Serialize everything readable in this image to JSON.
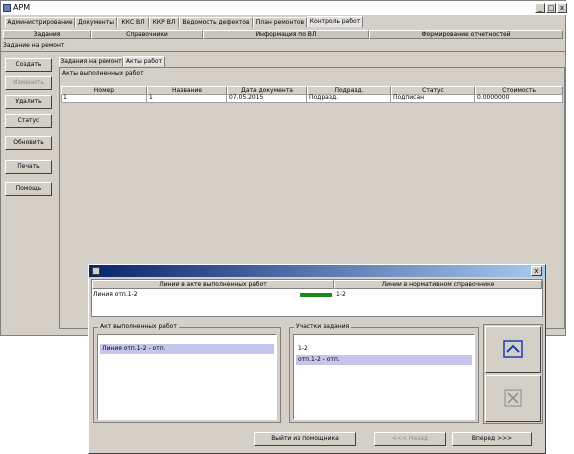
{
  "app": {
    "title": "АРМ"
  },
  "window_controls": {
    "minimize": "_",
    "maximize": "□",
    "close": "x"
  },
  "tabs": [
    {
      "label": "Администрирование"
    },
    {
      "label": "Документы"
    },
    {
      "label": "ККС ВЛ"
    },
    {
      "label": "ККР ВЛ"
    },
    {
      "label": "Ведомость дефектов"
    },
    {
      "label": "План ремонтов"
    },
    {
      "label": "Контроль работ"
    }
  ],
  "subtabs": [
    {
      "label": "Задания"
    },
    {
      "label": "Справочники"
    },
    {
      "label": "Информация по ВЛ"
    },
    {
      "label": "Формирование отчетностей"
    }
  ],
  "section_title": "Задание на ремонт",
  "side_buttons": [
    {
      "label": "Создать",
      "enabled": true
    },
    {
      "label": "Изменить",
      "enabled": false
    },
    {
      "label": "Удалить",
      "enabled": true
    },
    {
      "label": "Статус",
      "enabled": true
    },
    {
      "label": "Обновить",
      "enabled": true
    },
    {
      "label": "Печать",
      "enabled": true
    },
    {
      "label": "Помощь",
      "enabled": true
    }
  ],
  "inner_tabs": [
    {
      "label": "Задания на ремонт"
    },
    {
      "label": "Акты работ"
    }
  ],
  "table": {
    "caption": "Акты выполненных работ",
    "columns": [
      "Номер",
      "Название",
      "Дата документа",
      "Подразд.",
      "Статус",
      "Стоимость"
    ],
    "rows": [
      [
        "1",
        "1",
        "07.05.2015",
        "Подразд.",
        "Подписан",
        "0.0000000"
      ]
    ]
  },
  "dialog": {
    "header_left": "Линии в акте выполненных работ",
    "header_right": "Линии в нормативном справочнике",
    "line_left": "Линия отп.1-2",
    "line_right": "1-2",
    "progress_color": "#1a8a1a",
    "left_group": {
      "legend": "Акт выполненных работ",
      "items": [
        "Линия отп.1-2 - отп."
      ]
    },
    "right_group": {
      "legend": "Участки задания",
      "items": [
        "1-2",
        "отп.1-2 - отп."
      ]
    },
    "buttons": {
      "exit": "Выйти из помощника",
      "back": "<<< Назад",
      "next": "Вперед >>>"
    }
  }
}
